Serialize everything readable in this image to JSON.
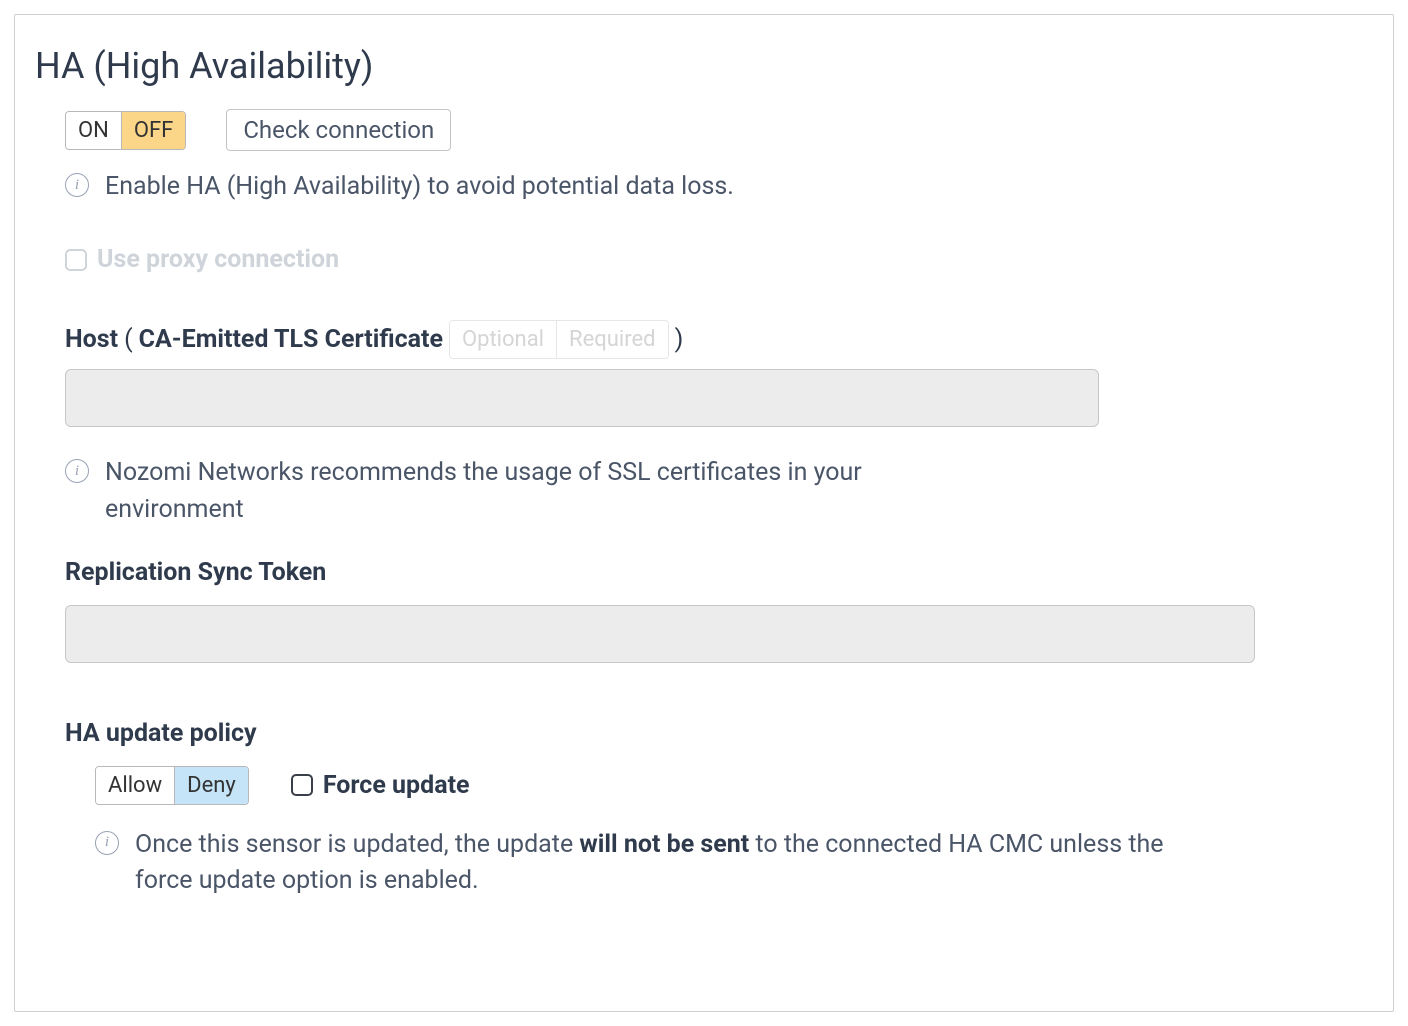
{
  "title": "HA (High Availability)",
  "ha_toggle": {
    "on": "ON",
    "off": "OFF"
  },
  "check_connection": "Check connection",
  "ha_hint": "Enable HA (High Availability) to avoid potential data loss.",
  "proxy": {
    "label": "Use proxy connection"
  },
  "host": {
    "label_prefix": "Host",
    "paren_open": "(",
    "cert_label": "CA-Emitted TLS Certificate",
    "optional": "Optional",
    "required": "Required",
    "paren_close": ")"
  },
  "host_hint": "Nozomi Networks recommends the usage of SSL certificates in your environment",
  "replication_label": "Replication Sync Token",
  "policy": {
    "label": "HA update policy",
    "allow": "Allow",
    "deny": "Deny",
    "force_label": "Force update",
    "hint_pre": "Once this sensor is updated, the update ",
    "hint_bold": "will not be sent",
    "hint_post": " to the connected HA CMC unless the force update option is enabled."
  }
}
